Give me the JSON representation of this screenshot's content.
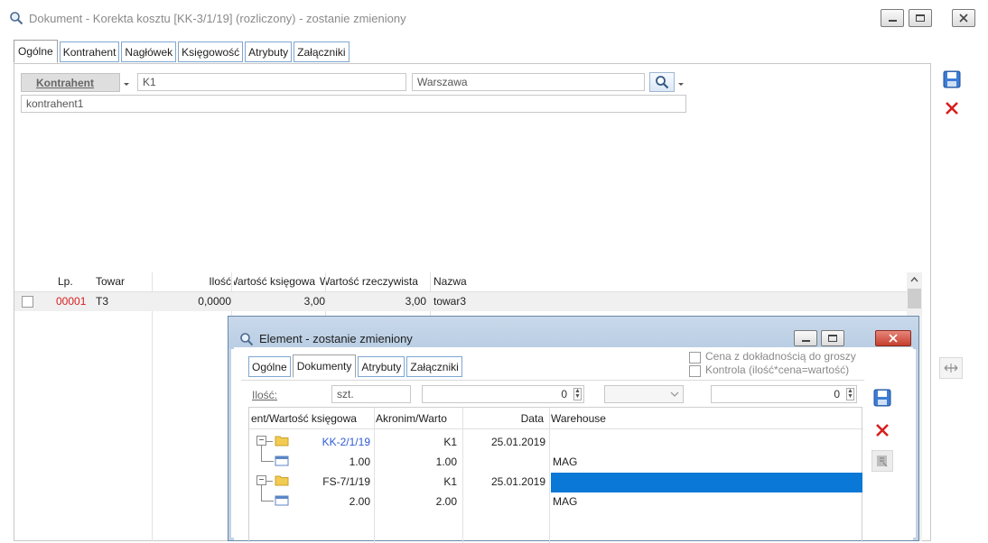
{
  "window": {
    "title": "Dokument - Korekta kosztu [KK-3/1/19] (rozliczony) - zostanie zmieniony"
  },
  "tabs": [
    {
      "label": "Ogólne"
    },
    {
      "label": "Kontrahent"
    },
    {
      "label": "Nagłówek"
    },
    {
      "label": "Księgowość"
    },
    {
      "label": "Atrybuty"
    },
    {
      "label": "Załączniki"
    }
  ],
  "contractor": {
    "button_label": "Kontrahent",
    "code": "K1",
    "city": "Warszawa",
    "name": "kontrahent1"
  },
  "grid": {
    "headers": {
      "lp": "Lp.",
      "towar": "Towar",
      "ilosc": "Ilość",
      "wartosc_ksiegowa": "Wartość księgowa",
      "wartosc_rzeczywista": "Wartość rzeczywista",
      "nazwa": "Nazwa"
    },
    "rows": [
      {
        "lp": "00001",
        "towar": "T3",
        "ilosc": "0,0000",
        "wartosc_ksiegowa": "3,00",
        "wartosc_rzeczywista": "3,00",
        "nazwa": "towar3"
      }
    ]
  },
  "dialog": {
    "title": "Element - zostanie zmieniony",
    "tabs": [
      {
        "label": "Ogólne"
      },
      {
        "label": "Dokumenty"
      },
      {
        "label": "Atrybuty"
      },
      {
        "label": "Załączniki"
      }
    ],
    "checkbox_cena": "Cena z dokładnością do groszy",
    "checkbox_kontrola": "Kontrola (ilość*cena=wartość)",
    "ilosc_label": "Ilość:",
    "unit": "szt.",
    "qty_value": "0",
    "value_value": "0",
    "tree_headers": {
      "col1": "ent/Wartość księgowa",
      "col2": "Akronim/Warto",
      "col3": "Data",
      "col4": "Warehouse"
    },
    "tree_rows": [
      {
        "c1": "KK-2/1/19",
        "c2": "K1",
        "c3": "25.01.2019",
        "c4": ""
      },
      {
        "c1": "1.00",
        "c2": "1.00",
        "c3": "",
        "c4": "MAG"
      },
      {
        "c1": "FS-7/1/19",
        "c2": "K1",
        "c3": "25.01.2019",
        "c4": ""
      },
      {
        "c1": "2.00",
        "c2": "2.00",
        "c3": "",
        "c4": "MAG"
      }
    ]
  }
}
